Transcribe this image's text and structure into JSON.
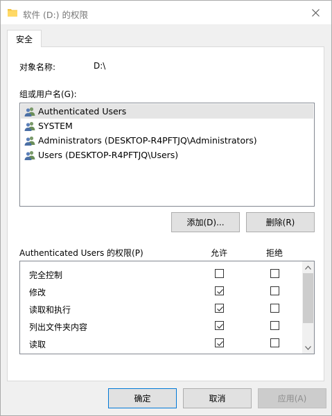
{
  "window": {
    "title": "软件 (D:) 的权限"
  },
  "tabs": [
    {
      "label": "安全"
    }
  ],
  "object": {
    "label": "对象名称:",
    "value": "D:\\"
  },
  "groups": {
    "label": "组或用户名(G):",
    "items": [
      {
        "name": "Authenticated Users",
        "selected": true
      },
      {
        "name": "SYSTEM",
        "selected": false
      },
      {
        "name": "Administrators (DESKTOP-R4PFTJQ\\Administrators)",
        "selected": false
      },
      {
        "name": "Users (DESKTOP-R4PFTJQ\\Users)",
        "selected": false
      }
    ],
    "add_label": "添加(D)...",
    "remove_label": "删除(R)"
  },
  "permissions": {
    "label": "Authenticated Users 的权限(P)",
    "allow_header": "允许",
    "deny_header": "拒绝",
    "items": [
      {
        "name": "完全控制",
        "allow": false,
        "deny": false
      },
      {
        "name": "修改",
        "allow": true,
        "deny": false
      },
      {
        "name": "读取和执行",
        "allow": true,
        "deny": false
      },
      {
        "name": "列出文件夹内容",
        "allow": true,
        "deny": false
      },
      {
        "name": "读取",
        "allow": true,
        "deny": false
      }
    ]
  },
  "buttons": {
    "ok": "确定",
    "cancel": "取消",
    "apply": "应用(A)"
  },
  "colors": {
    "folder": "#f5c542",
    "selection": "#e5e5e5",
    "focus_border": "#0078d7"
  }
}
